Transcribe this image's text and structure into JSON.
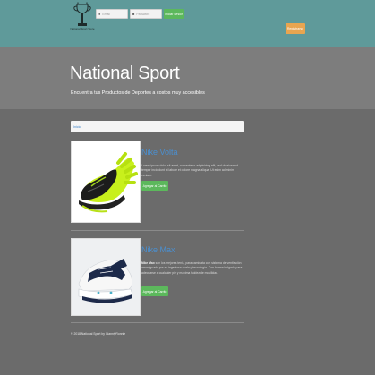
{
  "navbar": {
    "logo_caption": "National Sport Store",
    "email_placeholder": "Email",
    "password_placeholder": "Password",
    "login_label": "Iniciar Sesion",
    "register_label": "Registrarse"
  },
  "hero": {
    "title": "National Sport",
    "subtitle": "Encuentra tus Productos de Deportes a costos muy accesibles"
  },
  "breadcrumb": {
    "label": "Inicio"
  },
  "products": [
    {
      "name": "Nike Volta",
      "description": "Lorem ipsum dolor sit amet, consectetur adipisicing elit, sed do eiusmod tempor incididunt ut labore et dolore magna aliqua. Ut enim ad minim veniam.",
      "add_label": "Agregar al Carrito",
      "image_icon": "running-shoe-black-neon"
    },
    {
      "name": "Nike Max",
      "description_bold": "Nike Max",
      "description": " son los mejores tenis, para caminata con sistema de ventilación amortiguado por su ingeniosa suela y tecnología. Con horma holgada para adecuarse a cualquier pie y máxima fluidez de movilidad.",
      "add_label": "Agregar al Carrito",
      "image_icon": "running-shoe-navy-white"
    }
  ],
  "footer": {
    "text": "© 2018 National Sport by GianniyRonnie"
  },
  "colors": {
    "navbar": "#5f9a9a",
    "hero": "#7d7d7d",
    "body": "#6b6b6b",
    "success": "#5cb85c",
    "warning": "#e8a550",
    "link": "#4a8fd0"
  }
}
